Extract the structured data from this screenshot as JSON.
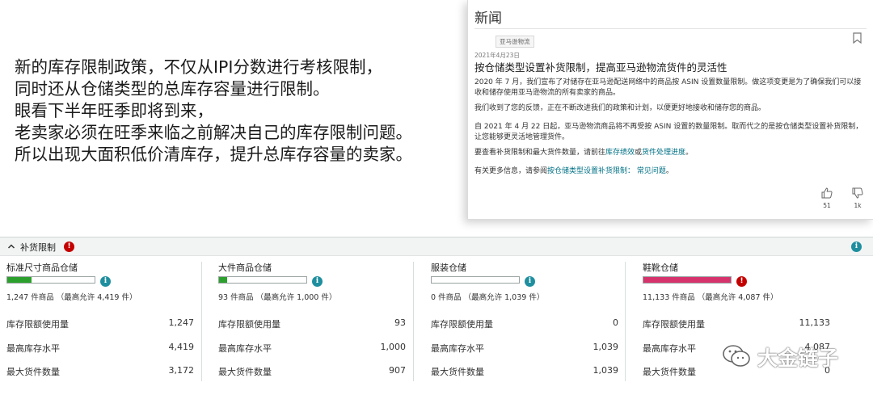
{
  "slide": {
    "lines": [
      "新的库存限制政策，不仅从IPI分数进行考核限制，",
      "同时还从仓储类型的总库存容量进行限制。",
      "眼看下半年旺季即将到来，",
      "老卖家必须在旺季来临之前解决自己的库存限制问题。",
      "所以出现大面积低价清库存，提升总库存容量的卖家。"
    ]
  },
  "news": {
    "heading": "新闻",
    "tag": "亚马逊物流",
    "date": "2021年4月23日",
    "title": "按仓储类型设置补货限制，提高亚马逊物流货件的灵活性",
    "p1": "2020 年 7 月，我们宣布了对储存在亚马逊配送网络中的商品按 ASIN 设置数量限制。做这项变更是为了确保我们可以接收和储存使用亚马逊物流的所有卖家的商品。",
    "p2": "我们收到了您的反馈，正在不断改进我们的政策和计划，以便更好地接收和储存您的商品。",
    "p3": "自 2021 年 4 月 22 日起，亚马逊物流商品将不再受按 ASIN 设置的数量限制。取而代之的是按仓储类型设置补货限制，让您能够更灵活地管理货件。",
    "p4_prefix": "要查看补货限制和最大货件数量，请前往",
    "p4_link1": "库存绩效",
    "p4_mid": "或",
    "p4_link2": "货件处理进度",
    "p4_suffix": "。",
    "p5_prefix": "有关更多信息，请参阅",
    "p5_link": "按仓储类型设置补货限制： 常见问题",
    "p5_suffix": "。",
    "likes": "51",
    "dislikes": "1k"
  },
  "panel": {
    "title": "补货限制",
    "row_labels": [
      "库存限额使用量",
      "最高库存水平",
      "最大货件数量"
    ],
    "columns": [
      {
        "title": "标准尺寸商品仓储",
        "summary": "1,247 件商品 （最高允许 4,419 件）",
        "fill": 0.28,
        "fill_color": "#2ca02c",
        "status": "info",
        "values": [
          "1,247",
          "4,419",
          "3,172"
        ]
      },
      {
        "title": "大件商品仓储",
        "summary": "93 件商品 （最高允许 1,000 件）",
        "fill": 0.09,
        "fill_color": "#2ca02c",
        "status": "info",
        "values": [
          "93",
          "1,000",
          "907"
        ]
      },
      {
        "title": "服装仓储",
        "summary": "0 件商品 （最高允许 1,039 件）",
        "fill": 0.0,
        "fill_color": "#2ca02c",
        "status": "info",
        "values": [
          "0",
          "1,039",
          "1,039"
        ]
      },
      {
        "title": "鞋靴仓储",
        "summary": "11,133 件商品 （最高允许 4,087 件）",
        "fill": 1.0,
        "fill_color": "#d6336c",
        "status": "alert",
        "values": [
          "11,133",
          "4,087",
          "0"
        ]
      }
    ]
  },
  "watermark": {
    "text": "大金链子"
  }
}
